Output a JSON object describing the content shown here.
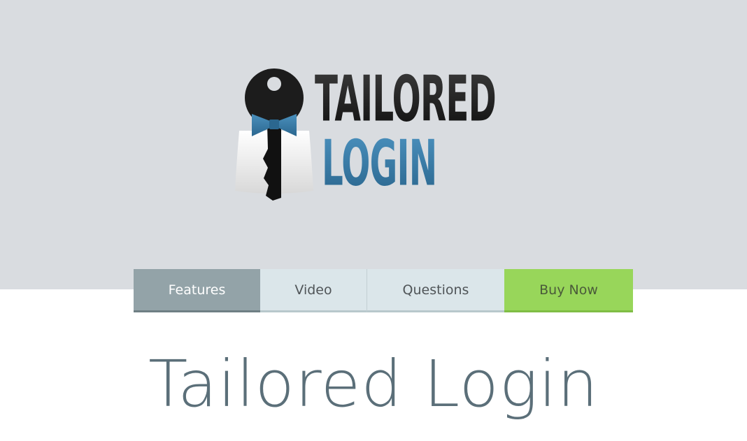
{
  "logo": {
    "line1": "TAILORED",
    "line2": "LOGIN",
    "colors": {
      "dark": "#1f1f1f",
      "blue": "#3b7eaa"
    },
    "icon": "key-with-bowtie-icon"
  },
  "nav": {
    "items": [
      {
        "label": "Features",
        "active": true
      },
      {
        "label": "Video"
      },
      {
        "label": "Questions"
      },
      {
        "label": "Buy Now",
        "accent": "#98d65a"
      }
    ]
  },
  "hero": {
    "title": "Tailored Login"
  },
  "colors": {
    "header_band": "#d9dce0",
    "nav_active": "#93a3a8",
    "nav_inactive": "#dbe6ea",
    "title": "#5b6f79"
  }
}
